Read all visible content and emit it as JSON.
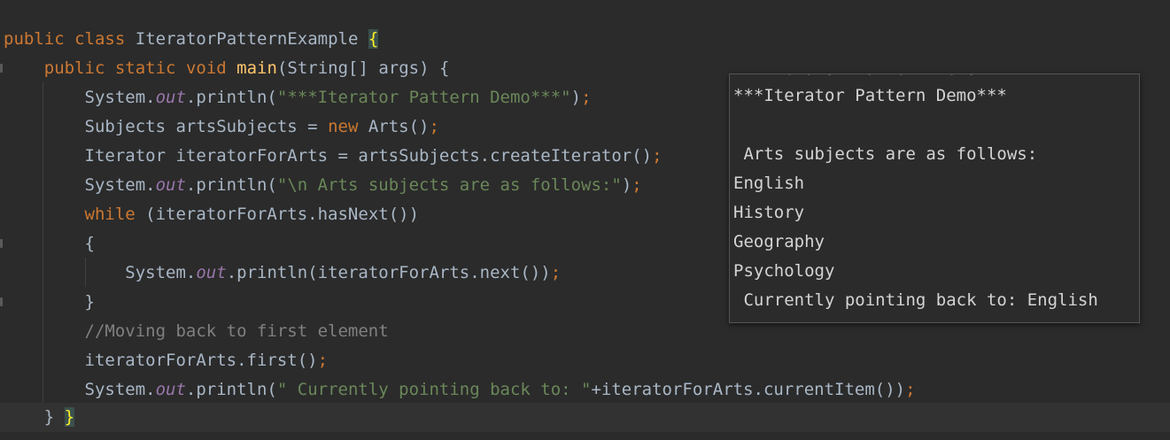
{
  "editor": {
    "class_decl": {
      "kw1": "public",
      "kw2": "class",
      "name": "IteratorPatternExample",
      "open_brace": "{"
    },
    "main_decl": {
      "kw1": "public",
      "kw2": "static",
      "kw3": "void",
      "name": "main",
      "params": "(String[] args) {"
    },
    "line_println1": {
      "obj": "System.",
      "field": "out",
      "call": ".println(",
      "str": "\"***Iterator Pattern Demo***\"",
      "end": ")",
      "semi": ";"
    },
    "line_subjects": {
      "type": "Subjects artsSubjects = ",
      "kw": "new",
      "rest": " Arts()",
      "semi": ";"
    },
    "line_iterator": {
      "text": "Iterator iteratorForArts = artsSubjects.createIterator()",
      "semi": ";"
    },
    "line_println2": {
      "obj": "System.",
      "field": "out",
      "call": ".println(",
      "str": "\"\\n Arts subjects are as follows:\"",
      "end": ")",
      "semi": ";"
    },
    "line_while": {
      "kw": "while",
      "rest": " (iteratorForArts.hasNext())"
    },
    "line_open": "{",
    "line_println3": {
      "obj": "System.",
      "field": "out",
      "call": ".println(iteratorForArts.next())",
      "semi": ";"
    },
    "line_close": "}",
    "line_comment": "//Moving back to first element",
    "line_first": {
      "text": "iteratorForArts.first()",
      "semi": ";"
    },
    "line_println4": {
      "obj": "System.",
      "field": "out",
      "call": ".println(",
      "str": "\" Currently pointing back to: \"",
      "rest": "+iteratorForArts.currentItem())",
      "semi": ";"
    },
    "line_end": {
      "brace1": "}",
      "brace2": "}"
    }
  },
  "output": {
    "cut_line": "***Iterator Pattern Demo***",
    "lines": [
      "***Iterator Pattern Demo***",
      "",
      " Arts subjects are as follows:",
      "English",
      "History",
      "Geography",
      "Psychology",
      " Currently pointing back to: English"
    ]
  }
}
